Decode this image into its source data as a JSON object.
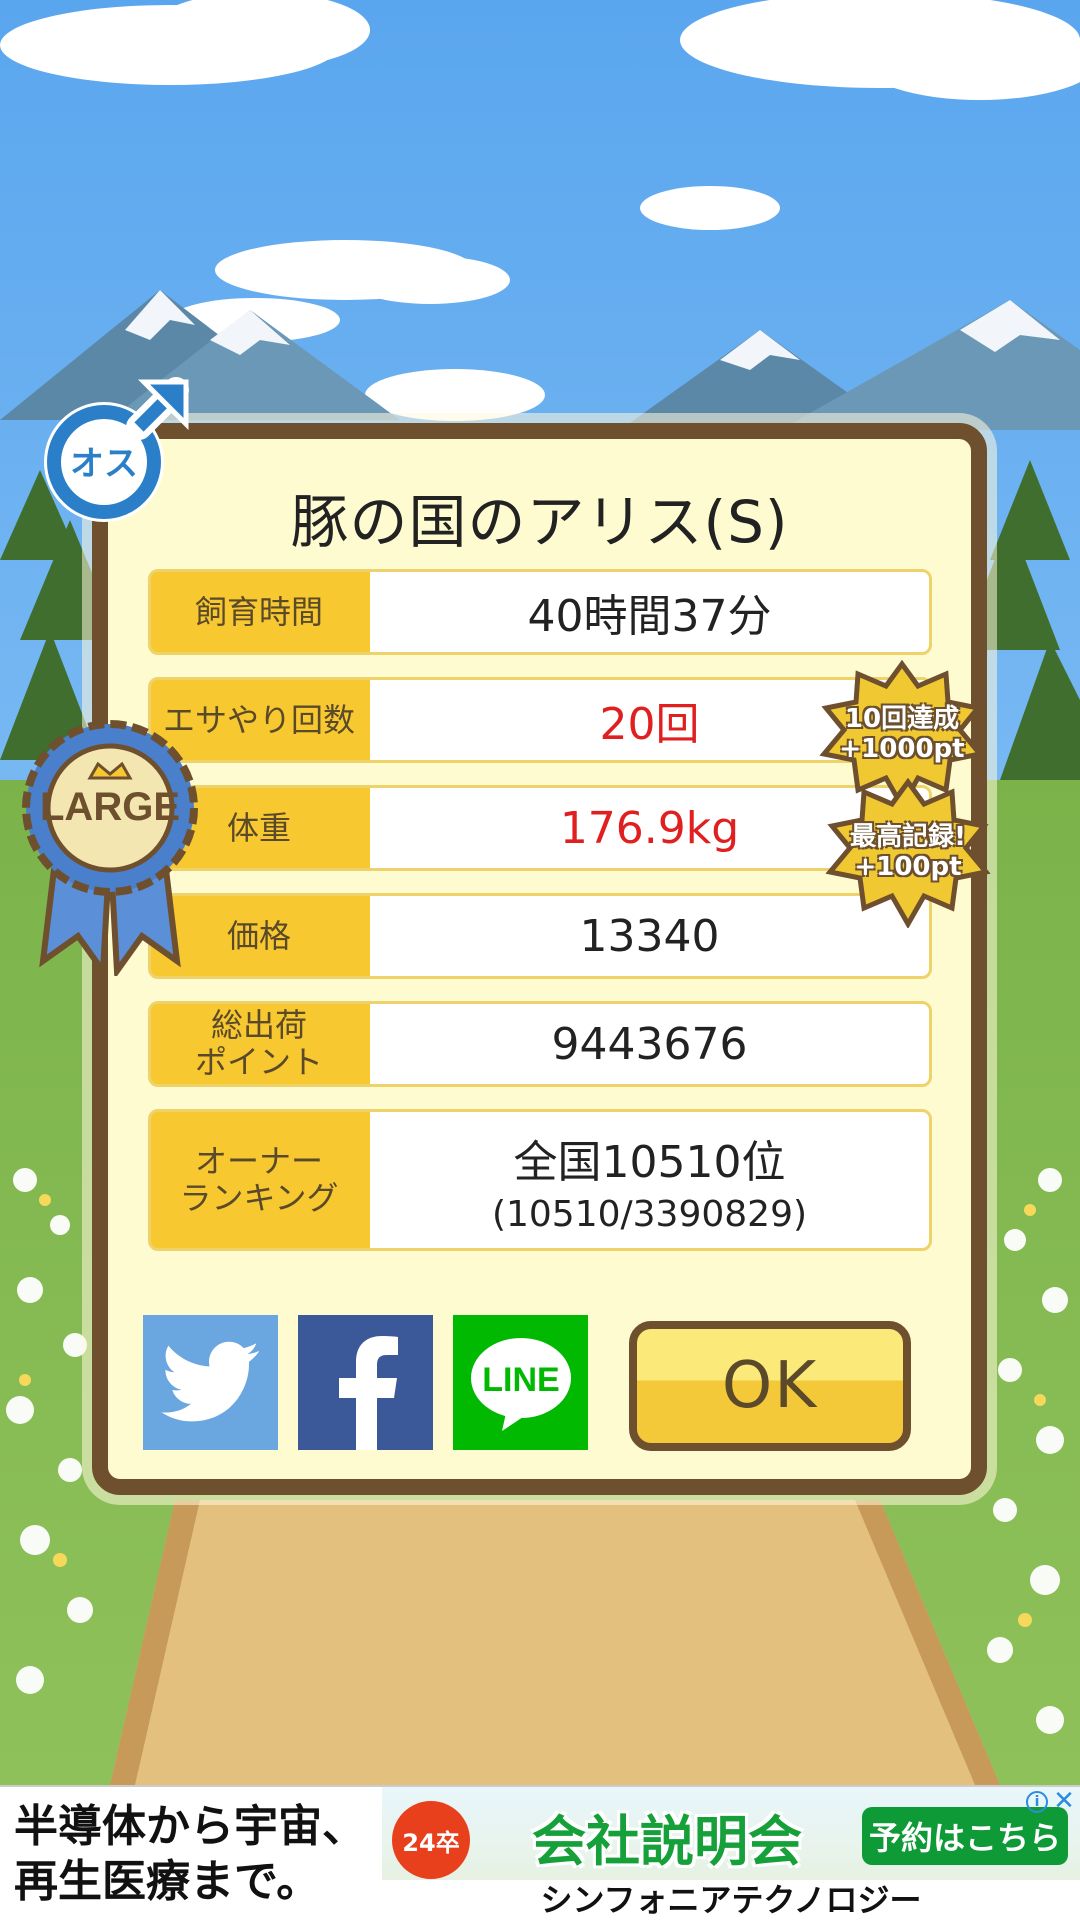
{
  "dialog": {
    "title": "豚の国のアリス(S)",
    "rows": [
      {
        "label": "飼育時間",
        "value": "40時間37分"
      },
      {
        "label": "エサやり回数",
        "value": "20回"
      },
      {
        "label": "体重",
        "value": "176.9kg"
      },
      {
        "label": "価格",
        "value": "13340"
      },
      {
        "label": "総出荷\nポイント",
        "value": "9443676"
      },
      {
        "label": "オーナー\nランキング",
        "value": "全国10510位",
        "sub": "(10510/3390829)"
      }
    ],
    "ok_label": "OK",
    "share": {
      "line_label": "LINE"
    }
  },
  "badges": {
    "gender": "オス",
    "size": "LARGE",
    "feed_bonus": {
      "line1": "10回達成",
      "line2": "+1000pt"
    },
    "weight_bonus": {
      "line1": "最高記録!",
      "line2": "+100pt"
    }
  },
  "ad": {
    "left_line1": "半導体から宇宙、",
    "left_line2": "再生医療まで。",
    "badge": "24卒",
    "headline": "会社説明会",
    "cta": "予約はこちら",
    "company": "シンフォニアテクノロジー",
    "info_icon": "i",
    "close_icon": "✕"
  },
  "colors": {
    "sky": "#79b8f0",
    "frame": "#6e4f2e",
    "panel": "#fffbd0",
    "label_bg": "#f7c830",
    "highlight": "#e02020",
    "twitter": "#6aa6e0",
    "facebook": "#3b5998",
    "line": "#00b900"
  }
}
